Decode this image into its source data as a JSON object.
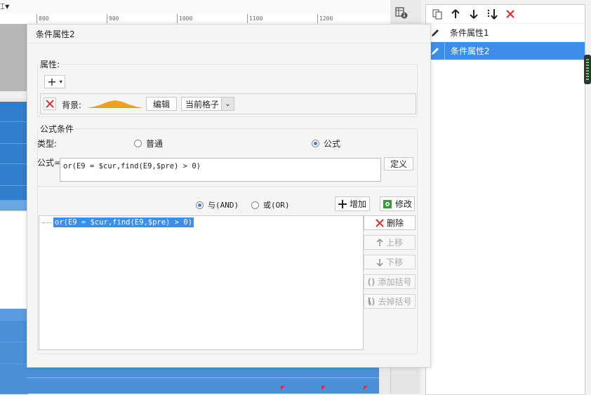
{
  "ruler": {
    "ticks": [
      "800",
      "900",
      "1000",
      "1100",
      "1200"
    ]
  },
  "right_panel": {
    "toolbar": {
      "copy_icon": "copy-icon",
      "up_icon": "arrow-up-icon",
      "down_icon": "arrow-down-icon",
      "sort_icon": "sort-down-icon",
      "delete_icon": "delete-icon"
    },
    "items": [
      {
        "label": "条件属性1",
        "selected": false
      },
      {
        "label": "条件属性2",
        "selected": true
      }
    ],
    "colors": {
      "selected": "#3d8ee8"
    }
  },
  "dialog": {
    "title": "条件属性2",
    "attributes": {
      "group_label": "属性:",
      "add_symbol": "+",
      "background_label": "背景:",
      "edit_button": "编辑",
      "scope_select": "当前格子"
    },
    "formula": {
      "group_label": "公式条件",
      "type_label": "类型:",
      "type_options": [
        {
          "label": "普通",
          "checked": false
        },
        {
          "label": "公式",
          "checked": true
        }
      ],
      "formula_label": "公式=",
      "formula_value": "or(E9 = $cur,find(E9,$pre) > 0)",
      "define_button": "定义",
      "and_label": "与(AND)",
      "or_label": "或(OR)",
      "and_checked": true,
      "add_button": "增加",
      "modify_button": "修改",
      "conditions": [
        "or(E9 = $cur,find(E9,$pre) > 0)"
      ],
      "side_buttons": [
        {
          "label": "删除",
          "icon": "x-icon",
          "enabled": true
        },
        {
          "label": "上移",
          "icon": "arrow-up-icon",
          "enabled": false
        },
        {
          "label": "下移",
          "icon": "arrow-down-icon",
          "enabled": false
        },
        {
          "label": "添加括号",
          "icon": "parentheses-icon",
          "enabled": false
        },
        {
          "label": "去掉括号",
          "icon": "remove-parentheses-icon",
          "enabled": false
        }
      ]
    },
    "colors": {
      "accent": "#3d8ee8",
      "delete": "#e03030",
      "bg_swatch": "#f0a020"
    }
  }
}
